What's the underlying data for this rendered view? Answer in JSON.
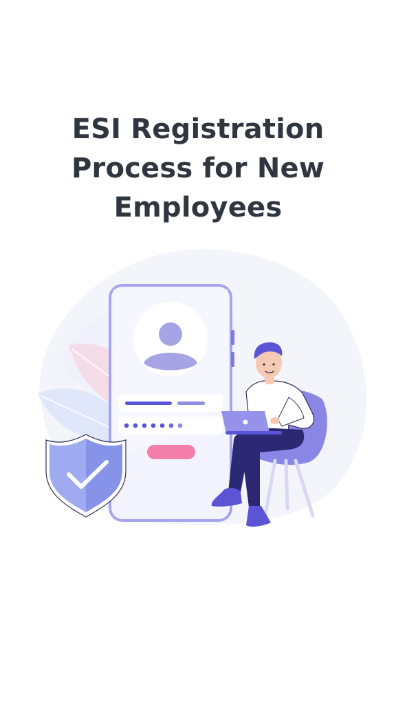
{
  "title": {
    "line1": "ESI Registration",
    "line2": "Process for New",
    "line3": "Employees"
  },
  "colors": {
    "background": "#ffffff",
    "title_text": "#2f3640",
    "accent_purple": "#5b55d6",
    "accent_pink": "#f27ea9",
    "phone_frame": "#a6a4ea",
    "blob": "#f3f3fb"
  },
  "icons": {
    "shield": "shield-check-icon",
    "avatar": "user-avatar-icon",
    "laptop": "laptop-icon"
  }
}
